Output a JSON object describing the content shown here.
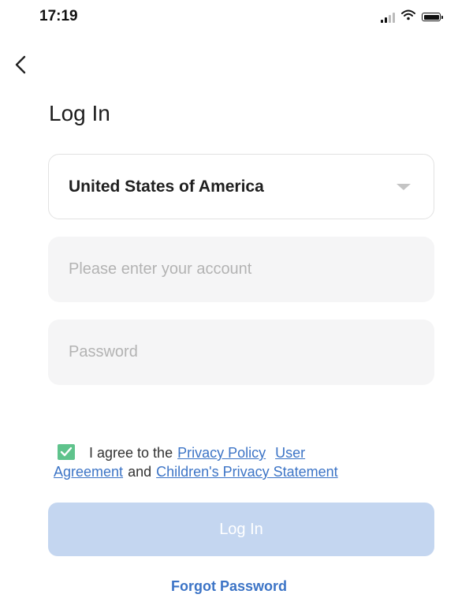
{
  "status_bar": {
    "time": "17:19",
    "icons": [
      "signal-icon",
      "wifi-icon",
      "battery-icon"
    ]
  },
  "nav": {
    "back_icon": "chevron-left-icon"
  },
  "page": {
    "title": "Log In"
  },
  "form": {
    "country": {
      "selected": "United States of America",
      "icon": "caret-down-icon"
    },
    "account": {
      "value": "",
      "placeholder": "Please enter your account"
    },
    "password": {
      "value": "",
      "placeholder": "Password"
    }
  },
  "agreement": {
    "checked": true,
    "text_prefix": "I agree to the",
    "privacy_policy": "Privacy Policy",
    "user_agreement_part1": "User",
    "user_agreement_part2": "Agreement",
    "conjunction": "and",
    "childrens_privacy": "Children's Privacy Statement"
  },
  "actions": {
    "login_label": "Log In",
    "forgot_password": "Forgot Password"
  },
  "colors": {
    "accent": "#3c74c6",
    "checkbox": "#5fc38c",
    "login_button_disabled": "#c4d6f0",
    "field_background": "#f5f5f6"
  }
}
